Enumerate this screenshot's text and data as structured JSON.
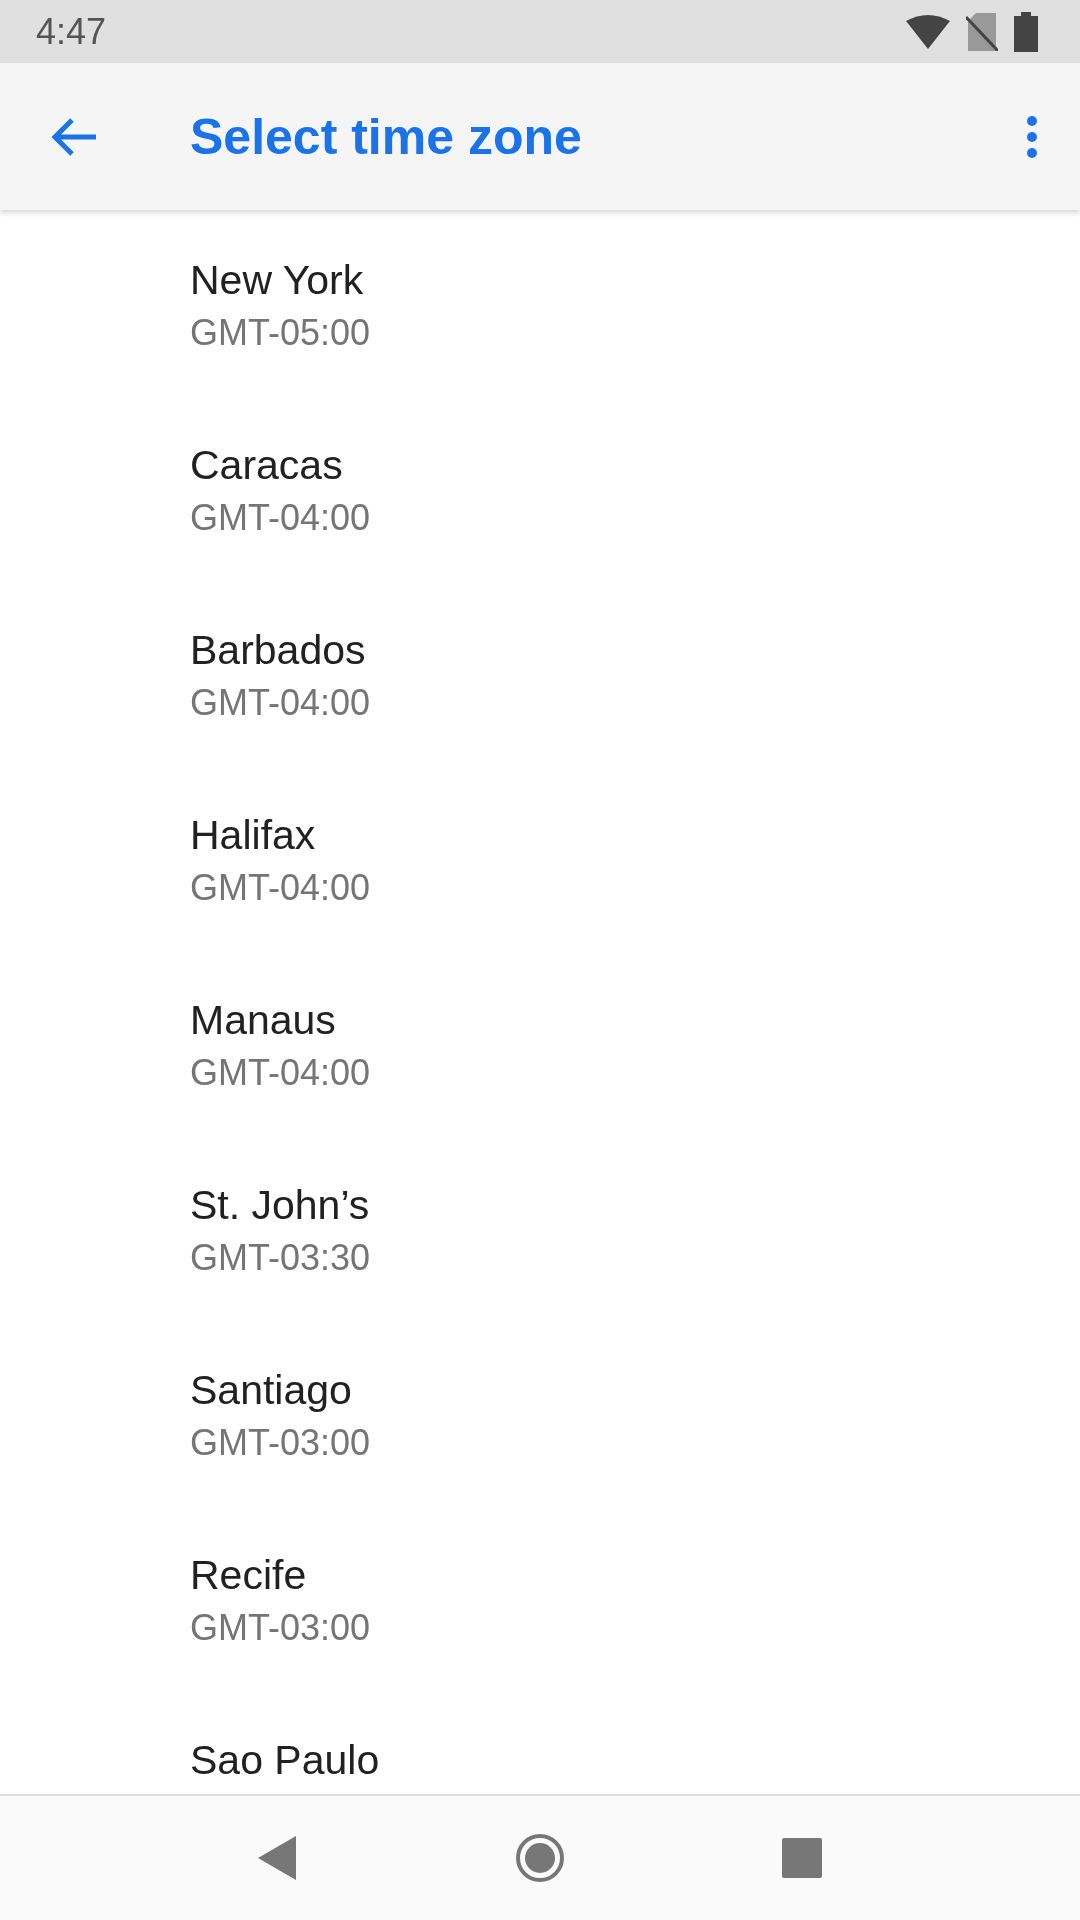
{
  "status_bar": {
    "time": "4:47"
  },
  "app_bar": {
    "title": "Select time zone"
  },
  "time_zones": [
    {
      "name": "New York",
      "offset": "GMT-05:00"
    },
    {
      "name": "Caracas",
      "offset": "GMT-04:00"
    },
    {
      "name": "Barbados",
      "offset": "GMT-04:00"
    },
    {
      "name": "Halifax",
      "offset": "GMT-04:00"
    },
    {
      "name": "Manaus",
      "offset": "GMT-04:00"
    },
    {
      "name": "St. John’s",
      "offset": "GMT-03:30"
    },
    {
      "name": "Santiago",
      "offset": "GMT-03:00"
    },
    {
      "name": "Recife",
      "offset": "GMT-03:00"
    },
    {
      "name": "Sao Paulo"
    }
  ]
}
